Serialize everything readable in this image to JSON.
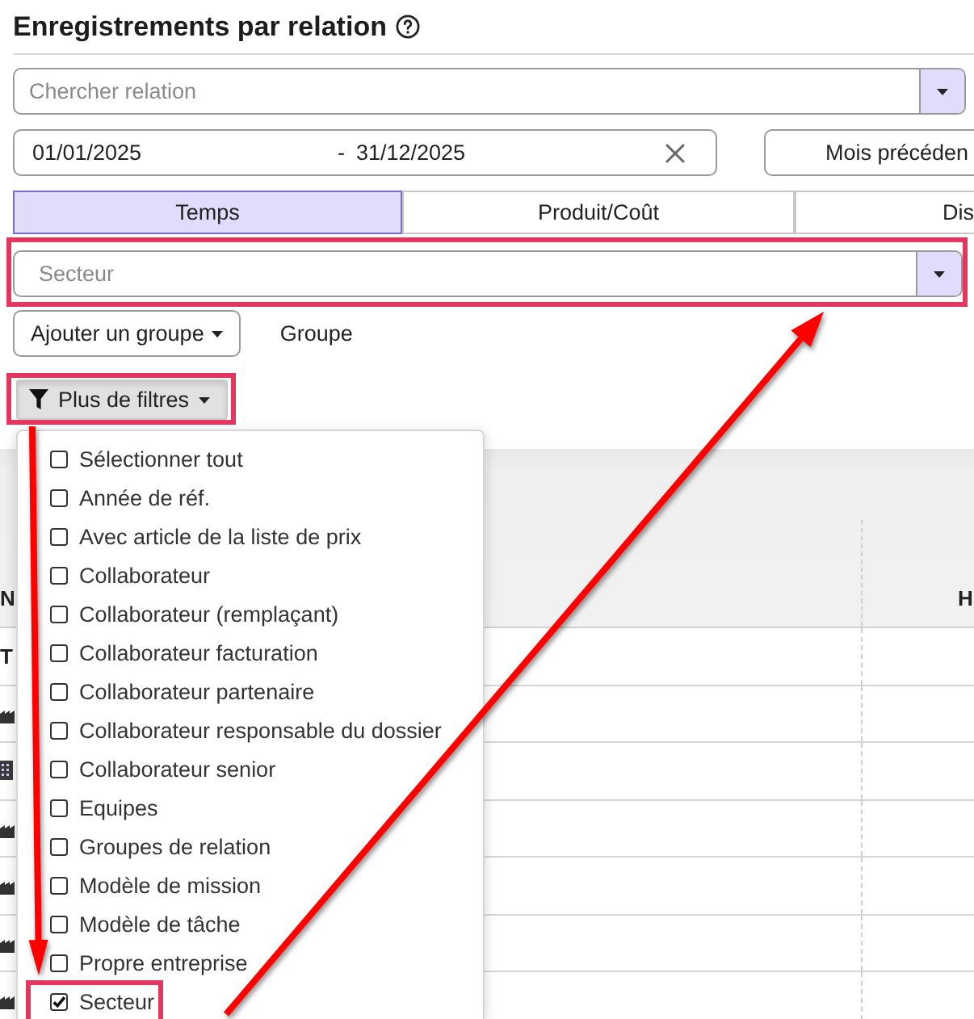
{
  "page": {
    "title": "Enregistrements par relation"
  },
  "relation_search": {
    "placeholder": "Chercher relation"
  },
  "date_range": {
    "start": "01/01/2025",
    "separator": "-",
    "end": "31/12/2025"
  },
  "period_button": {
    "label": "Mois précéden"
  },
  "tabs": [
    {
      "label": "Temps",
      "selected": true
    },
    {
      "label": "Produit/Coût",
      "selected": false
    },
    {
      "label": "Dis",
      "selected": false
    }
  ],
  "group_filter": {
    "placeholder": "Secteur",
    "highlighted": true
  },
  "add_group_button": {
    "label": "Ajouter un groupe"
  },
  "group_label": "Groupe",
  "more_filters_button": {
    "label": "Plus de filtres",
    "highlighted": true,
    "expanded": true
  },
  "filter_menu": {
    "items": [
      {
        "label": "Sélectionner tout",
        "checked": false,
        "highlighted": false
      },
      {
        "label": "Année de réf.",
        "checked": false,
        "highlighted": false
      },
      {
        "label": "Avec article de la liste de prix",
        "checked": false,
        "highlighted": false
      },
      {
        "label": "Collaborateur",
        "checked": false,
        "highlighted": false
      },
      {
        "label": "Collaborateur (remplaçant)",
        "checked": false,
        "highlighted": false
      },
      {
        "label": "Collaborateur facturation",
        "checked": false,
        "highlighted": false
      },
      {
        "label": "Collaborateur partenaire",
        "checked": false,
        "highlighted": false
      },
      {
        "label": "Collaborateur responsable du dossier",
        "checked": false,
        "highlighted": false
      },
      {
        "label": "Collaborateur senior",
        "checked": false,
        "highlighted": false
      },
      {
        "label": "Equipes",
        "checked": false,
        "highlighted": false
      },
      {
        "label": "Groupes de relation",
        "checked": false,
        "highlighted": false
      },
      {
        "label": "Modèle de mission",
        "checked": false,
        "highlighted": false
      },
      {
        "label": "Modèle de tâche",
        "checked": false,
        "highlighted": false
      },
      {
        "label": "Propre entreprise",
        "checked": false,
        "highlighted": false
      },
      {
        "label": "Secteur",
        "checked": true,
        "highlighted": true
      }
    ]
  },
  "table": {
    "columns": [
      "N",
      "H"
    ],
    "rows": [
      {
        "kind": "total",
        "cells": [
          "T"
        ]
      },
      {
        "kind": "factory"
      },
      {
        "kind": "building"
      },
      {
        "kind": "factory"
      },
      {
        "kind": "factory"
      },
      {
        "kind": "factory"
      },
      {
        "kind": "factory"
      }
    ]
  }
}
